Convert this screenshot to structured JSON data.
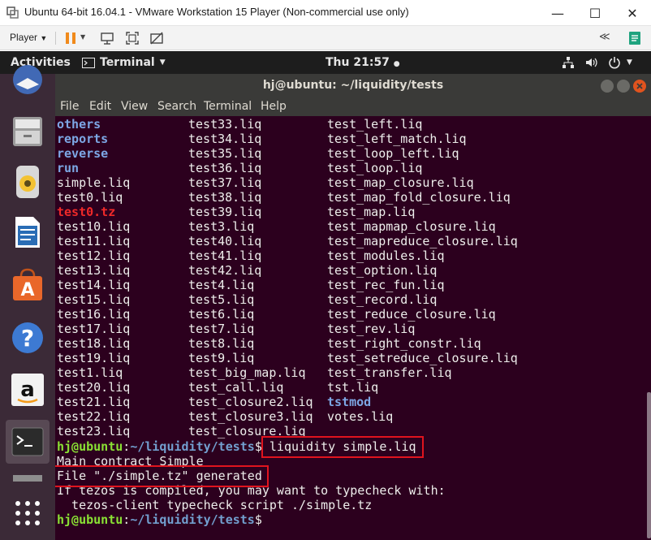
{
  "vmware": {
    "title": "Ubuntu 64-bit 16.04.1 - VMware Workstation 15 Player (Non-commercial use only)",
    "player_label": "Player",
    "minimize": "—",
    "maximize": "☐",
    "close": "✕"
  },
  "topbar": {
    "activities": "Activities",
    "app_menu": "Terminal",
    "clock": "Thu 21:57"
  },
  "terminal": {
    "title": "hj@ubuntu: ~/liquidity/tests",
    "menu": [
      "File",
      "Edit",
      "View",
      "Search",
      "Terminal",
      "Help"
    ],
    "listing": [
      [
        "others",
        "test33.liq",
        "test_left.liq"
      ],
      [
        "reports",
        "test34.liq",
        "test_left_match.liq"
      ],
      [
        "reverse",
        "test35.liq",
        "test_loop_left.liq"
      ],
      [
        "run",
        "test36.liq",
        "test_loop.liq"
      ],
      [
        "simple.liq",
        "test37.liq",
        "test_map_closure.liq"
      ],
      [
        "test0.liq",
        "test38.liq",
        "test_map_fold_closure.liq"
      ],
      [
        "test0.tz",
        "test39.liq",
        "test_map.liq"
      ],
      [
        "test10.liq",
        "test3.liq",
        "test_mapmap_closure.liq"
      ],
      [
        "test11.liq",
        "test40.liq",
        "test_mapreduce_closure.liq"
      ],
      [
        "test12.liq",
        "test41.liq",
        "test_modules.liq"
      ],
      [
        "test13.liq",
        "test42.liq",
        "test_option.liq"
      ],
      [
        "test14.liq",
        "test4.liq",
        "test_rec_fun.liq"
      ],
      [
        "test15.liq",
        "test5.liq",
        "test_record.liq"
      ],
      [
        "test16.liq",
        "test6.liq",
        "test_reduce_closure.liq"
      ],
      [
        "test17.liq",
        "test7.liq",
        "test_rev.liq"
      ],
      [
        "test18.liq",
        "test8.liq",
        "test_right_constr.liq"
      ],
      [
        "test19.liq",
        "test9.liq",
        "test_setreduce_closure.liq"
      ],
      [
        "test1.liq",
        "test_big_map.liq",
        "test_transfer.liq"
      ],
      [
        "test20.liq",
        "test_call.liq",
        "tst.liq"
      ],
      [
        "test21.liq",
        "test_closure2.liq",
        "tstmod"
      ],
      [
        "test22.liq",
        "test_closure3.liq",
        "votes.liq"
      ],
      [
        "test23.liq",
        "test_closure.liq",
        ""
      ]
    ],
    "prompt_user": "hj@ubuntu",
    "prompt_sep": ":",
    "prompt_path": "~/liquidity/tests",
    "prompt_end": "$",
    "command": " liquidity simple.liq",
    "out1": "Main contract Simple",
    "out2": "File \"./simple.tz\" generated",
    "out3": "If tezos is compiled, you may want to typecheck with:",
    "out4": "  tezos-client typecheck script ./simple.tz"
  },
  "colors": {
    "terminal_bg": "#2c001e",
    "directory": "#7da7e5",
    "archive": "#ef2929",
    "prompt_user": "#8ae234",
    "prompt_path": "#729fcf",
    "highlight_box": "#e0141e"
  },
  "dock_icons": [
    "thunderbird-icon",
    "files-icon",
    "rhythmbox-icon",
    "libreoffice-writer-icon",
    "software-center-icon",
    "help-icon",
    "amazon-icon",
    "terminal-icon",
    "trash-icon",
    "app-grid-icon"
  ]
}
